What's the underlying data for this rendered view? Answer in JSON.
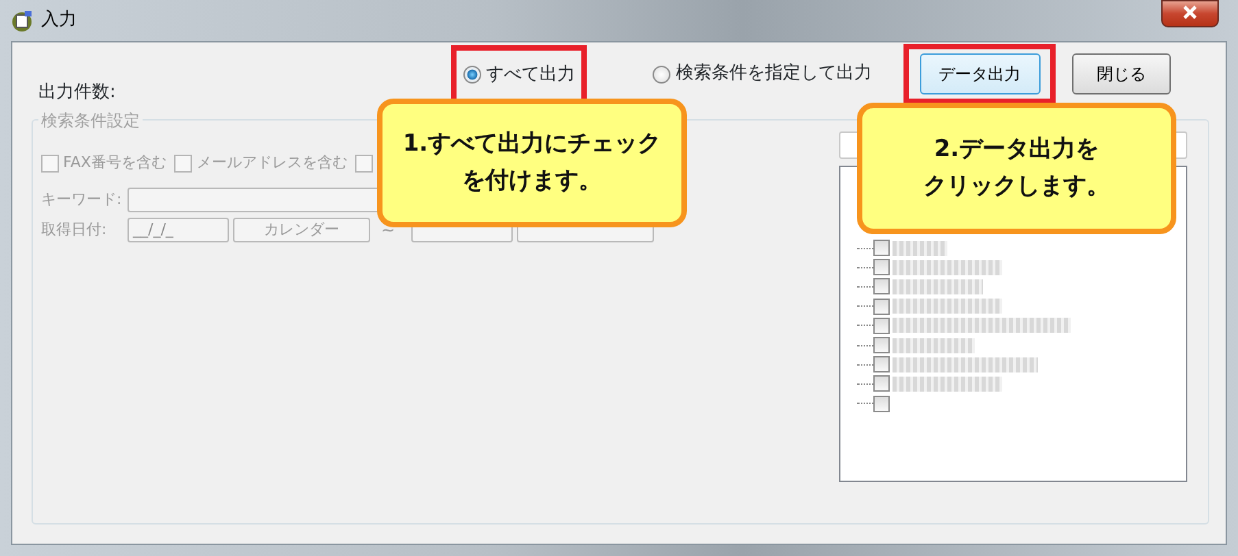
{
  "window": {
    "title": "入力"
  },
  "count_label": "出力件数:",
  "radios": [
    {
      "label": "すべて出力",
      "selected": true,
      "highlighted": true
    },
    {
      "label": "検索条件を指定して出力",
      "selected": false,
      "highlighted": false
    }
  ],
  "buttons": [
    {
      "label": "データ出力",
      "focused": true,
      "highlighted": true
    },
    {
      "label": "閉じる",
      "focused": false,
      "highlighted": false
    }
  ],
  "group": {
    "title": "検索条件設定",
    "checkboxes": [
      {
        "label": "FAX番号を含む",
        "checked": false
      },
      {
        "label": "メールアドレスを含む",
        "checked": false
      },
      {
        "checked": false
      }
    ],
    "keyword_label": "キーワード:",
    "date_label": "取得日付:",
    "date_from": "__/_/_",
    "calendar_from": "カレンダー",
    "range_sep": "~",
    "tree": [
      {
        "checked": false
      },
      {
        "checked": false
      },
      {
        "checked": false
      },
      {
        "checked": false
      },
      {
        "checked": false
      },
      {
        "checked": false
      },
      {
        "checked": false
      },
      {
        "checked": false
      },
      {
        "checked": false
      }
    ]
  },
  "callouts": [
    {
      "lines": [
        "1.すべて出力にチェック",
        "を付けます。"
      ]
    },
    {
      "lines": [
        "2.データ出力を",
        "クリックします。"
      ]
    }
  ]
}
